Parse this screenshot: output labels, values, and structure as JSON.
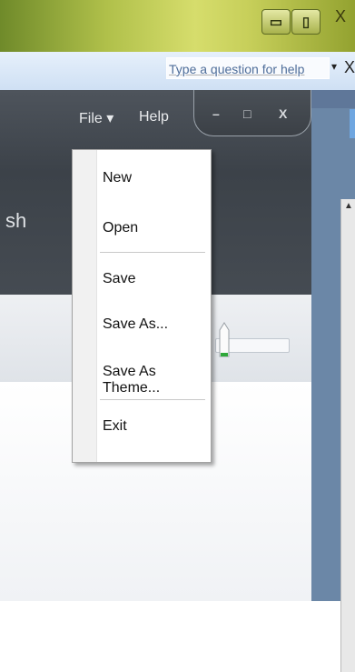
{
  "outer_window": {
    "minimize_glyph": "▭",
    "restore_glyph": "▯",
    "close_label": "X"
  },
  "help_bar": {
    "question_placeholder": "Type a question for help",
    "dropdown_glyph": "▾",
    "close_label": "X"
  },
  "app_window": {
    "menu": {
      "file_label": "File ▾",
      "help_label": "Help"
    },
    "caption_buttons": {
      "minimize_glyph": "–",
      "maximize_glyph": "□",
      "close_label": "X"
    },
    "title_fragment": "sh"
  },
  "file_menu": {
    "items": [
      {
        "label": "New"
      },
      {
        "label": "Open"
      },
      {
        "label": "Save"
      },
      {
        "label": "Save As..."
      },
      {
        "label": "Save As Theme..."
      },
      {
        "label": "Exit"
      }
    ]
  },
  "slider": {
    "level": 0.05
  },
  "colors": {
    "slider_thumb_accent": "#2fa83a",
    "header_dark": "#3c4249",
    "help_strip": "#cfe0f4"
  }
}
